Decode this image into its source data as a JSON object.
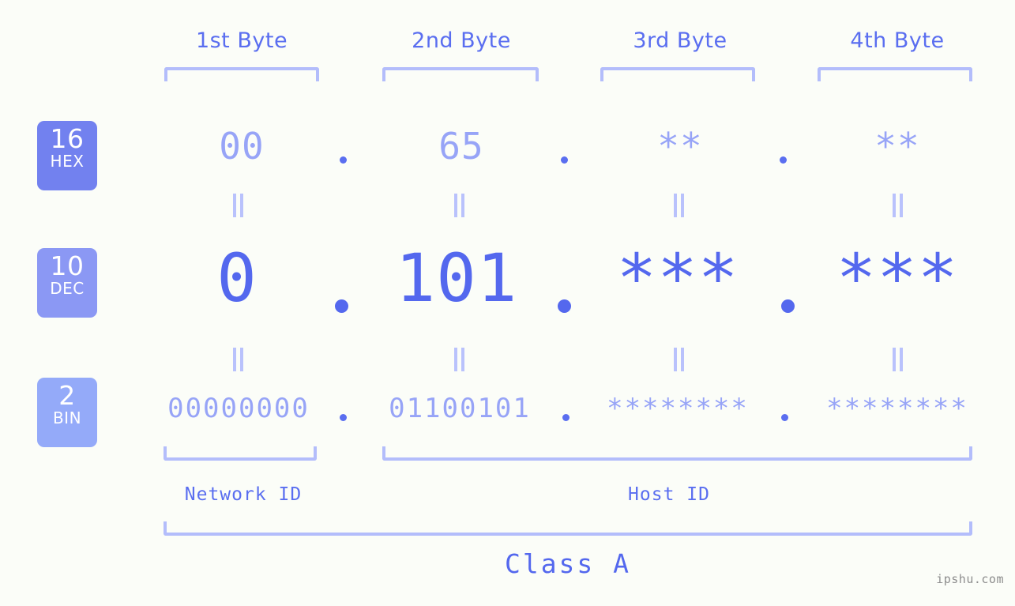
{
  "background": "#fbfdf8",
  "accent": {
    "strong": "#5468ee",
    "mid": "#7281ef",
    "soft": "#97a4f7",
    "pale": "#b3bdfb"
  },
  "header": {
    "bytes": [
      {
        "label": "1st Byte"
      },
      {
        "label": "2nd Byte"
      },
      {
        "label": "3rd Byte"
      },
      {
        "label": "4th Byte"
      }
    ]
  },
  "bases": [
    {
      "number": "16",
      "name": "HEX",
      "color": "#7281ef"
    },
    {
      "number": "10",
      "name": "DEC",
      "color": "#8b98f4"
    },
    {
      "number": "2",
      "name": "BIN",
      "color": "#94aaf9"
    }
  ],
  "rows": {
    "hex": {
      "base_number": "16",
      "base_name": "HEX",
      "values": [
        "00",
        "65",
        "**",
        "**"
      ],
      "separator": "."
    },
    "dec": {
      "base_number": "10",
      "base_name": "DEC",
      "values": [
        "0",
        "101",
        "***",
        "***"
      ],
      "separator": "."
    },
    "bin": {
      "base_number": "2",
      "base_name": "BIN",
      "values": [
        "00000000",
        "01100101",
        "********",
        "********"
      ],
      "separator": "."
    }
  },
  "equality_marks": {
    "symbol": "||",
    "count_per_row": 4
  },
  "segments": {
    "network_id": "Network ID",
    "host_id": "Host ID",
    "class": "Class A"
  },
  "watermark": "ipshu.com"
}
